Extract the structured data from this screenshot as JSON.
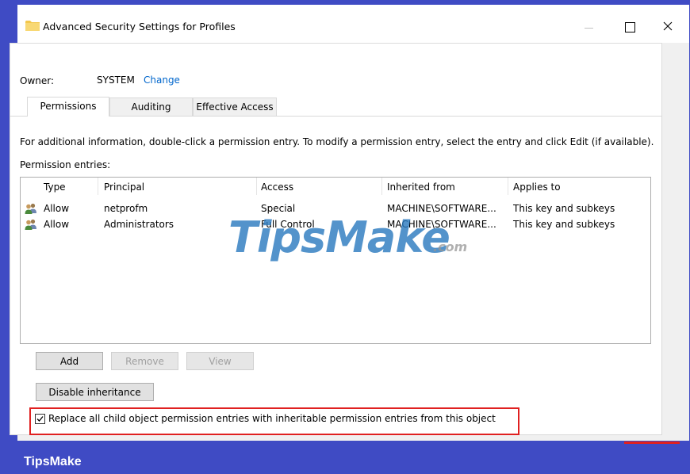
{
  "window": {
    "title": "Advanced Security Settings for Profiles",
    "controls": {
      "minimize": "minimize-icon",
      "maximize": "maximize-icon",
      "close": "close-icon"
    }
  },
  "owner": {
    "label": "Owner:",
    "value": "SYSTEM",
    "change_link": "Change"
  },
  "tabs": [
    {
      "label": "Permissions",
      "active": true
    },
    {
      "label": "Auditing",
      "active": false
    },
    {
      "label": "Effective Access",
      "active": false
    }
  ],
  "info_text": "For additional information, double-click a permission entry. To modify a permission entry, select the entry and click Edit (if available).",
  "entries_label": "Permission entries:",
  "table": {
    "columns": [
      "Type",
      "Principal",
      "Access",
      "Inherited from",
      "Applies to"
    ],
    "rows": [
      {
        "type": "Allow",
        "principal": "netprofm",
        "access": "Special",
        "inherited_from": "MACHINE\\SOFTWARE...",
        "applies_to": "This key and subkeys"
      },
      {
        "type": "Allow",
        "principal": "Administrators",
        "access": "Full Control",
        "inherited_from": "MACHINE\\SOFTWARE...",
        "applies_to": "This key and subkeys"
      }
    ]
  },
  "buttons": {
    "add": "Add",
    "remove": "Remove",
    "view": "View",
    "disable_inheritance": "Disable inheritance"
  },
  "replace_checkbox": {
    "label": "Replace all child object permission entries with inheritable permission entries from this object",
    "checked": true
  },
  "watermark": {
    "text": "TipsMake",
    "suffix": ".com"
  },
  "footer": {
    "brand": "TipsMake"
  },
  "colors": {
    "accent": "#3f4bc4",
    "link": "#0066cc",
    "highlight": "#e02020"
  }
}
